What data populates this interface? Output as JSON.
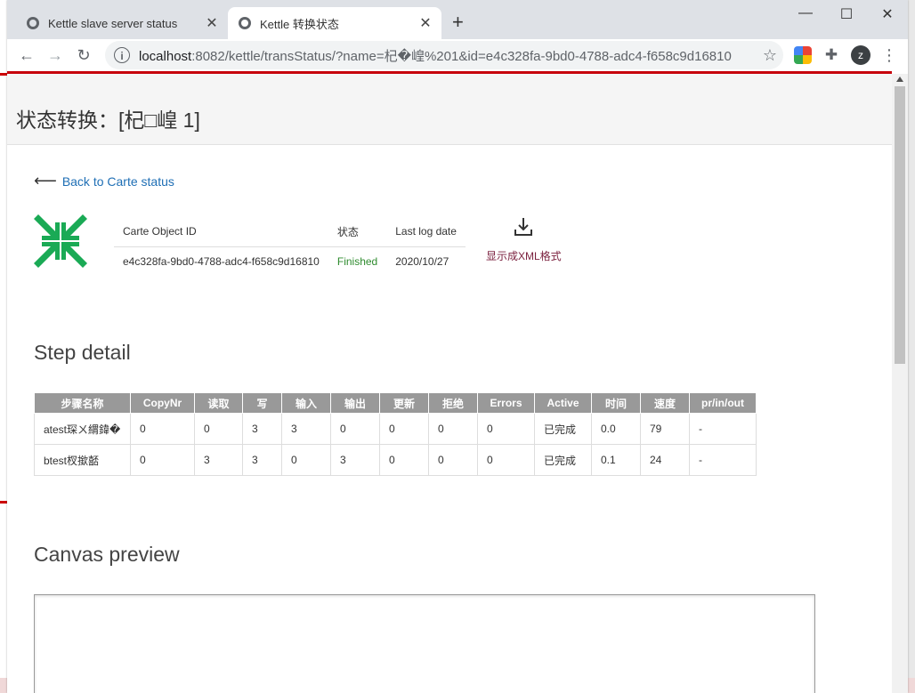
{
  "browser": {
    "tabs": [
      {
        "title": "Kettle slave server status"
      },
      {
        "title": "Kettle 转换状态"
      }
    ],
    "url_host": "localhost",
    "url_path": ":8082/kettle/transStatus/?name=杞�崲%201&id=e4c328fa-9bd0-4788-adc4-f658c9d16810",
    "profile_initial": "z"
  },
  "page": {
    "title": "状态转换：[杞□崲 1]",
    "back_link": "Back to Carte status",
    "info": {
      "headers": [
        "Carte Object ID",
        "状态",
        "Last log date"
      ],
      "object_id": "e4c328fa-9bd0-4788-adc4-f658c9d16810",
      "status": "Finished",
      "last_log_date": "2020/10/27"
    },
    "xml_link": "显示成XML格式",
    "step_detail_title": "Step detail",
    "steps": {
      "headers": [
        "步骤名称",
        "CopyNr",
        "读取",
        "写",
        "输入",
        "输出",
        "更新",
        "拒绝",
        "Errors",
        "Active",
        "时间",
        "速度",
        "pr/in/out"
      ],
      "rows": [
        [
          "atest琛ㄨ緭鍏�",
          "0",
          "0",
          "3",
          "3",
          "0",
          "0",
          "0",
          "0",
          "已完成",
          "0.0",
          "79",
          "-"
        ],
        [
          "btest杈撳嚭",
          "0",
          "3",
          "3",
          "0",
          "3",
          "0",
          "0",
          "0",
          "已完成",
          "0.1",
          "24",
          "-"
        ]
      ]
    },
    "canvas_title": "Canvas preview"
  },
  "colors": {
    "accent_red": "#c7000b",
    "link_blue": "#1f6fb5",
    "finished_green": "#2e8b2e",
    "table_header_gray": "#999999",
    "logo_green": "#1aaa55"
  }
}
